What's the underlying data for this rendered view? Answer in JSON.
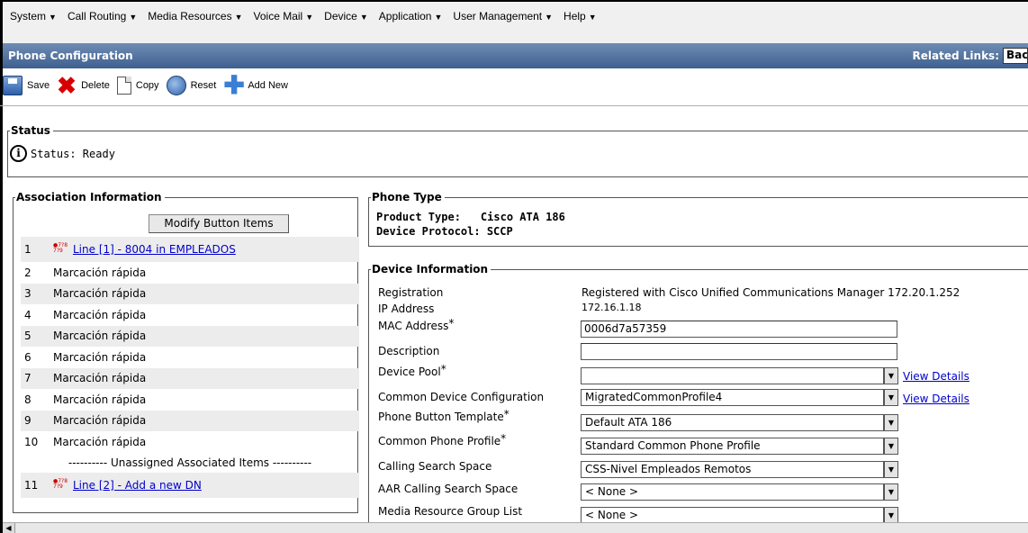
{
  "menu": [
    {
      "label": "System"
    },
    {
      "label": "Call Routing"
    },
    {
      "label": "Media Resources"
    },
    {
      "label": "Voice Mail"
    },
    {
      "label": "Device"
    },
    {
      "label": "Application"
    },
    {
      "label": "User Management"
    },
    {
      "label": "Help"
    }
  ],
  "header": {
    "title": "Phone Configuration",
    "related_links_label": "Related Links:",
    "related_links_value": "Bac"
  },
  "toolbar": {
    "save": "Save",
    "delete": "Delete",
    "copy": "Copy",
    "reset": "Reset",
    "add_new": "Add New"
  },
  "status": {
    "legend": "Status",
    "text": "Status: Ready"
  },
  "association": {
    "legend": "Association Information",
    "modify_button": "Modify Button Items",
    "line1": {
      "num": "1",
      "link": "Line [1] - 8004 in EMPLEADOS"
    },
    "speed_dials": [
      {
        "num": "2",
        "label": "Marcación rápida"
      },
      {
        "num": "3",
        "label": "Marcación rápida"
      },
      {
        "num": "4",
        "label": "Marcación rápida"
      },
      {
        "num": "5",
        "label": "Marcación rápida"
      },
      {
        "num": "6",
        "label": "Marcación rápida"
      },
      {
        "num": "7",
        "label": "Marcación rápida"
      },
      {
        "num": "8",
        "label": "Marcación rápida"
      },
      {
        "num": "9",
        "label": "Marcación rápida"
      },
      {
        "num": "10",
        "label": "Marcación rápida"
      }
    ],
    "unassigned": "---------- Unassigned Associated Items ----------",
    "line2": {
      "num": "11",
      "link": "Line [2] - Add a new DN"
    }
  },
  "phone_type": {
    "legend": "Phone Type",
    "product_type_label": "Product Type:",
    "product_type_value": "Cisco ATA 186",
    "protocol_label": "Device Protocol:",
    "protocol_value": "SCCP"
  },
  "device_info": {
    "legend": "Device Information",
    "registration_label": "Registration",
    "registration_value": "Registered with Cisco Unified Communications Manager 172.20.1.252",
    "ip_label": "IP Address",
    "ip_value": "172.16.1.18",
    "mac_label": "MAC Address",
    "mac_value": "0006d7a57359",
    "description_label": "Description",
    "description_value": "",
    "device_pool_label": "Device Pool",
    "device_pool_value": "",
    "common_device_config_label": "Common Device Configuration",
    "common_device_config_value": "MigratedCommonProfile4",
    "phone_button_template_label": "Phone Button Template",
    "phone_button_template_value": "Default ATA 186",
    "common_phone_profile_label": "Common Phone Profile",
    "common_phone_profile_value": "Standard Common Phone Profile",
    "css_label": "Calling Search Space",
    "css_value": "CSS-Nivel Empleados Remotos",
    "aar_css_label": "AAR Calling Search Space",
    "aar_css_value": "< None >",
    "mrgl_label": "Media Resource Group List",
    "mrgl_value": "< None >",
    "view_details": "View Details",
    "required_mark": "*"
  },
  "colors": {
    "title_bar": "#4f6f9c",
    "link": "#0000cc",
    "row_shade": "#ececec"
  }
}
